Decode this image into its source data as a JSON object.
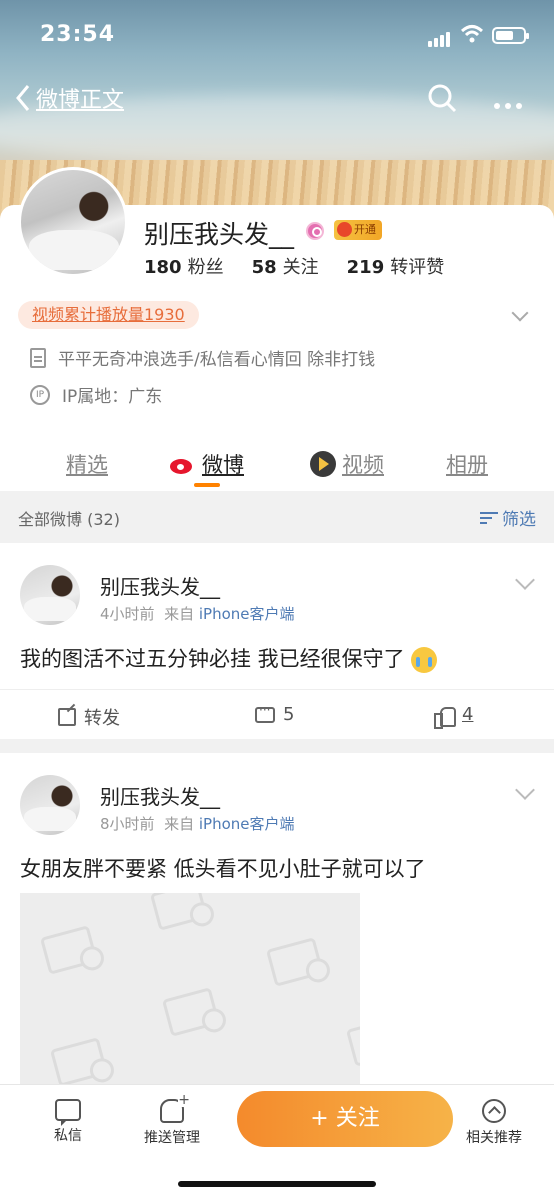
{
  "status_bar": {
    "time": "23:54"
  },
  "nav": {
    "back_label": "微博正文"
  },
  "profile": {
    "name": "别压我头发__",
    "open_badge": "开通",
    "fans_count": "180",
    "fans_label": "粉丝",
    "following_count": "58",
    "following_label": "关注",
    "likes_count": "219",
    "likes_label": "转评赞",
    "video_views": "视频累计播放量1930",
    "bio": "平平无奇冲浪选手/私信看心情回 除非打钱",
    "ip_badge": "IP",
    "ip_location": "IP属地：广东"
  },
  "tabs": [
    {
      "label": "精选"
    },
    {
      "label": "微博"
    },
    {
      "label": "视频"
    },
    {
      "label": "相册"
    }
  ],
  "filter_bar": {
    "label": "全部微博 (32)",
    "filter_label": "筛选"
  },
  "posts": [
    {
      "author": "别压我头发__",
      "time": "4小时前",
      "from_label": "来自",
      "source": "iPhone客户端",
      "text": "我的图活不过五分钟必挂 我已经很保守了",
      "repost_label": "转发",
      "comments": "5",
      "likes": "4"
    },
    {
      "author": "别压我头发__",
      "time": "8小时前",
      "from_label": "来自",
      "source": "iPhone客户端",
      "text": "女朋友胖不要紧 低头看不见小肚子就可以了"
    }
  ],
  "bottom_bar": {
    "message_label": "私信",
    "push_label": "推送管理",
    "follow_label": "+ 关注",
    "recommend_label": "相关推荐"
  },
  "colors": {
    "accent_orange": "#ff8200",
    "link_blue": "#4f7bb4",
    "follow_start": "#f48a2c",
    "follow_end": "#f6b348"
  }
}
